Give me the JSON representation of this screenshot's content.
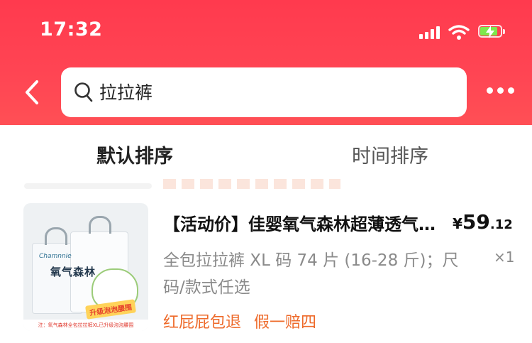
{
  "status_bar": {
    "time": "17:32",
    "icons": [
      "signal-icon",
      "wifi-icon",
      "battery-charging-icon"
    ],
    "battery_color": "#7ee84c"
  },
  "header": {
    "accent": "#ff3a4e",
    "back_icon": "back-arrow-icon",
    "search_icon": "search-icon",
    "search_query": "拉拉裤",
    "more_icon": "more-dots-icon"
  },
  "tabs": [
    {
      "label": "默认排序",
      "active": true
    },
    {
      "label": "时间排序",
      "active": false
    }
  ],
  "product": {
    "image_text": {
      "brand": "Chamnnie",
      "name": "氧气森林",
      "badge": "升级泡泡腰围",
      "footer": "注：氧气森林全包拉拉裤XL已升级泡泡腰围"
    },
    "title": "【活动价】佳婴氧气森林超薄透气拉拉裤",
    "price_symbol": "¥",
    "price_int": "59",
    "price_dec": ".12",
    "spec": "全包拉拉裤 XL 码 74 片 (16-28 斤)；尺码/款式任选",
    "quantity": "×1",
    "tags": [
      "红屁屁包退",
      "假一赔四"
    ],
    "tag_color": "#ee6a2a"
  }
}
